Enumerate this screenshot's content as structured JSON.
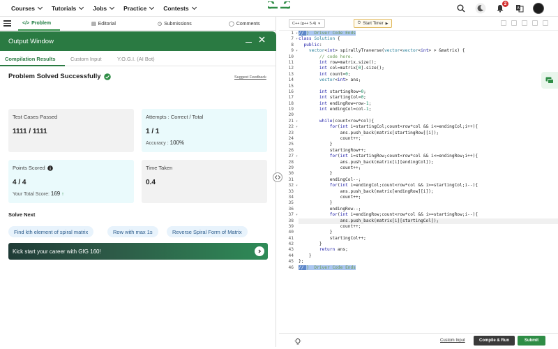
{
  "nav": {
    "items": [
      {
        "label": "Courses"
      },
      {
        "label": "Tutorials"
      },
      {
        "label": "Jobs"
      },
      {
        "label": "Practice"
      },
      {
        "label": "Contests"
      }
    ],
    "logo_text": "GG",
    "notifications": "2",
    "accent": "#2f8d46"
  },
  "left_tabs": {
    "problem": "Problem",
    "editorial": "Editorial",
    "submissions": "Submissions",
    "comments": "Comments"
  },
  "output_window": {
    "title": "Output Window",
    "tabs": [
      "Compilation Results",
      "Custom Input",
      "Y.O.G.I. (AI Bot)"
    ]
  },
  "result": {
    "status": "Problem Solved Successfully",
    "feedback": "Suggest Feedback",
    "test_cases_label": "Test Cases Passed",
    "test_cases_value": "1111 / 1111",
    "attempts_label": "Attempts : Correct / Total",
    "attempts_value": "1 / 1",
    "accuracy_label": "Accuracy :",
    "accuracy_value": "100%",
    "points_label": "Points Scored",
    "points_value": "4 / 4",
    "total_score_label": "Your Total Score:",
    "total_score_value": "169",
    "time_label": "Time Taken",
    "time_value": "0.4"
  },
  "solve_next": {
    "heading": "Solve Next",
    "chips": [
      "Find kth element of spiral matrix",
      "Row with max 1s",
      "Reverse Spiral Form of Matrix"
    ],
    "banner": "Kick start your career with GfG 160!"
  },
  "editor": {
    "language": "C++ (g++ 5.4)",
    "timer": "Start Timer",
    "custom_input": "Custom Input",
    "compile": "Compile & Run",
    "submit": "Submit"
  },
  "code_lines": [
    {
      "n": "1",
      "f": "▾",
      "t": "// } Driver Code Ends",
      "hl": true
    },
    {
      "n": "7",
      "f": "▾",
      "t": "class Solution {"
    },
    {
      "n": "8",
      "f": "",
      "t": "  public:"
    },
    {
      "n": "9",
      "f": "▾",
      "t": "    vector<int> spirallyTraverse(vector<vector<int> > &matrix) {"
    },
    {
      "n": "10",
      "f": "",
      "t": "        // code here."
    },
    {
      "n": "11",
      "f": "",
      "t": "        int row=matrix.size();"
    },
    {
      "n": "12",
      "f": "",
      "t": "        int col=matrix[0].size();"
    },
    {
      "n": "13",
      "f": "",
      "t": "        int count=0;"
    },
    {
      "n": "14",
      "f": "",
      "t": "        vector<int> ans;"
    },
    {
      "n": "15",
      "f": "",
      "t": ""
    },
    {
      "n": "16",
      "f": "",
      "t": "        int startingRow=0;"
    },
    {
      "n": "17",
      "f": "",
      "t": "        int startingCol=0;"
    },
    {
      "n": "18",
      "f": "",
      "t": "        int endingRow=row-1;"
    },
    {
      "n": "19",
      "f": "",
      "t": "        int endingCol=col-1;"
    },
    {
      "n": "20",
      "f": "",
      "t": ""
    },
    {
      "n": "21",
      "f": "▾",
      "t": "        while(count<row*col){"
    },
    {
      "n": "22",
      "f": "▾",
      "t": "            for(int i=startingCol;count<row*col && i<=endingCol;i++){"
    },
    {
      "n": "23",
      "f": "",
      "t": "                ans.push_back(matrix[startingRow][i]);"
    },
    {
      "n": "24",
      "f": "",
      "t": "                count++;"
    },
    {
      "n": "25",
      "f": "",
      "t": "            }"
    },
    {
      "n": "26",
      "f": "",
      "t": "            startingRow++;"
    },
    {
      "n": "27",
      "f": "▾",
      "t": "            for(int i=startingRow;count<row*col && i<=endingRow;i++){"
    },
    {
      "n": "28",
      "f": "",
      "t": "                ans.push_back(matrix[i][endingCol]);"
    },
    {
      "n": "29",
      "f": "",
      "t": "                count++;"
    },
    {
      "n": "30",
      "f": "",
      "t": "            }"
    },
    {
      "n": "31",
      "f": "",
      "t": "            endingCol--;"
    },
    {
      "n": "32",
      "f": "▾",
      "t": "            for(int i=endingCol;count<row*col && i>=startingCol;i--){"
    },
    {
      "n": "33",
      "f": "",
      "t": "                ans.push_back(matrix[endingRow][i]);"
    },
    {
      "n": "34",
      "f": "",
      "t": "                count++;"
    },
    {
      "n": "35",
      "f": "",
      "t": "            }"
    },
    {
      "n": "36",
      "f": "",
      "t": "            endingRow--;"
    },
    {
      "n": "37",
      "f": "▾",
      "t": "            for(int i=endingRow;count<row*col && i>=startingRow;i--){"
    },
    {
      "n": "38",
      "f": "",
      "t": "                ans.push_back(matrix[i][startingCol]);",
      "cur": true
    },
    {
      "n": "39",
      "f": "",
      "t": "                count++;"
    },
    {
      "n": "40",
      "f": "",
      "t": "            }"
    },
    {
      "n": "41",
      "f": "",
      "t": "            startingCol++;"
    },
    {
      "n": "42",
      "f": "",
      "t": "        }"
    },
    {
      "n": "43",
      "f": "",
      "t": "        return ans;"
    },
    {
      "n": "44",
      "f": "",
      "t": "    }"
    },
    {
      "n": "45",
      "f": "",
      "t": "};"
    },
    {
      "n": "46",
      "f": "",
      "t": "// } Driver Code Ends",
      "hl": true
    }
  ]
}
